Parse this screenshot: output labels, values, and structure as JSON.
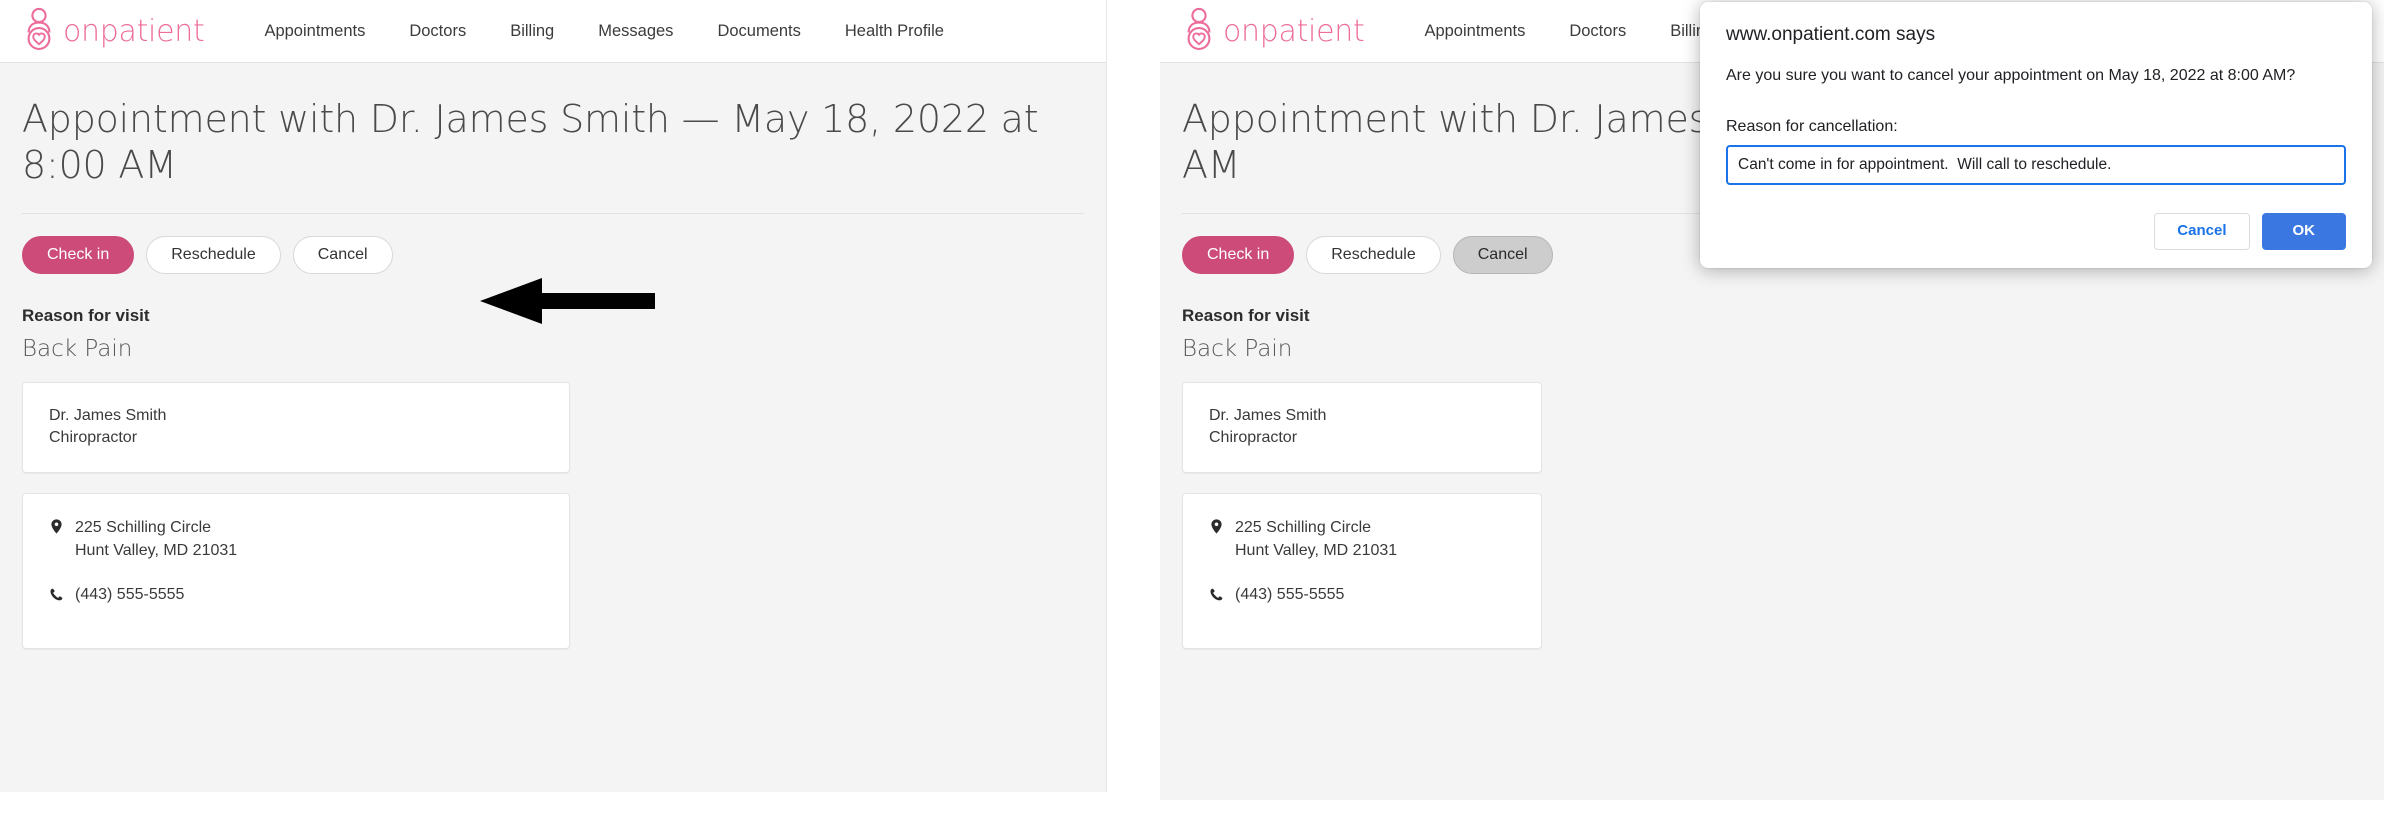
{
  "brand": {
    "name": "onpatient",
    "logo_icon": "person-heart-logo-icon",
    "color": "#ec6c9b"
  },
  "nav": {
    "items": [
      {
        "label": "Appointments"
      },
      {
        "label": "Doctors"
      },
      {
        "label": "Billing"
      },
      {
        "label": "Messages"
      },
      {
        "label": "Documents"
      },
      {
        "label": "Health Profile"
      }
    ]
  },
  "appointment": {
    "title": "Appointment with Dr. James Smith — May 18, 2022 at 8:00 AM",
    "actions": {
      "check_in": "Check in",
      "reschedule": "Reschedule",
      "cancel": "Cancel"
    },
    "reason_heading": "Reason for visit",
    "reason_value": "Back Pain",
    "provider": {
      "name": "Dr. James Smith",
      "specialty": "Chiropractor"
    },
    "location": {
      "address_icon": "map-pin-icon",
      "address_line1": "225 Schilling Circle",
      "address_line2": "Hunt Valley, MD 21031",
      "phone_icon": "phone-icon",
      "phone": "(443) 555-5555"
    }
  },
  "annotation": {
    "arrow_icon": "left-arrow-pointer-icon",
    "color": "#000000"
  },
  "dialog": {
    "title": "www.onpatient.com says",
    "message": "Are you sure you want to cancel your appointment on May 18, 2022 at 8:00 AM?",
    "input_label": "Reason for cancellation:",
    "input_value": "Can't come in for appointment.  Will call to reschedule.",
    "input_placeholder": "",
    "cancel_label": "Cancel",
    "ok_label": "OK",
    "accent_color": "#1a73e8",
    "ok_color": "#3b77e0"
  }
}
